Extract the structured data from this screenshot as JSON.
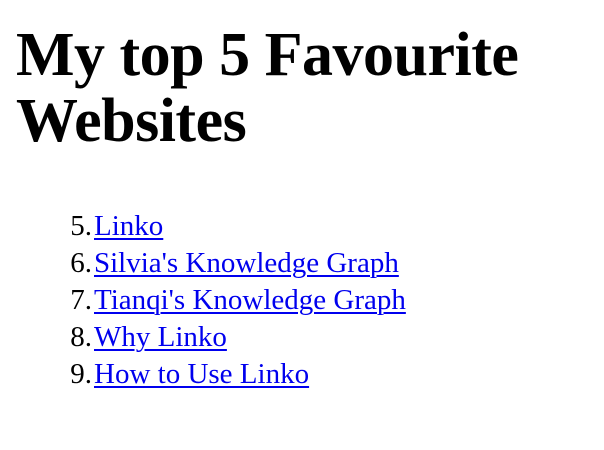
{
  "page": {
    "title": "My top 5 Favourite Websites"
  },
  "links": [
    {
      "number": "5.",
      "label": "Linko"
    },
    {
      "number": "6.",
      "label": "Silvia's Knowledge Graph"
    },
    {
      "number": "7.",
      "label": "Tianqi's Knowledge Graph"
    },
    {
      "number": "8.",
      "label": "Why Linko"
    },
    {
      "number": "9.",
      "label": "How to Use Linko"
    }
  ],
  "colors": {
    "link": "#0000ee",
    "text": "#000000",
    "background": "#ffffff"
  }
}
